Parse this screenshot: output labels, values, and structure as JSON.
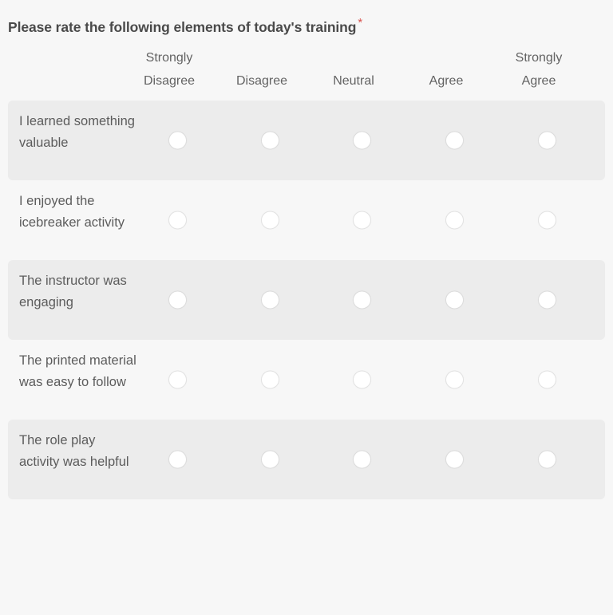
{
  "question": {
    "title": "Please rate the following elements of today's training",
    "required_marker": "*",
    "required_color": "#d9534f"
  },
  "matrix": {
    "columns": [
      {
        "label": "Strongly Disagree",
        "lines": [
          "Strongly",
          "Disagree"
        ]
      },
      {
        "label": "Disagree",
        "lines": [
          "Disagree"
        ]
      },
      {
        "label": "Neutral",
        "lines": [
          "Neutral"
        ]
      },
      {
        "label": "Agree",
        "lines": [
          "Agree"
        ]
      },
      {
        "label": "Strongly Agree",
        "lines": [
          "Strongly",
          "Agree"
        ]
      }
    ],
    "rows": [
      {
        "label": "I learned something valuable",
        "selected": null,
        "striped": true
      },
      {
        "label": "I enjoyed the icebreaker activity",
        "selected": null,
        "striped": false
      },
      {
        "label": "The instructor was engaging",
        "selected": null,
        "striped": true
      },
      {
        "label": "The printed material was easy to follow",
        "selected": null,
        "striped": false
      },
      {
        "label": "The role play activity was helpful",
        "selected": null,
        "striped": true
      }
    ]
  },
  "theme": {
    "page_background": "#f7f7f7",
    "striped_row_background": "#ececec",
    "title_color": "#4a4a4a",
    "header_text_color": "#636363",
    "row_label_color": "#5c5c5c",
    "radio_fill": "#ffffff",
    "radio_border": "#e0e0e0"
  }
}
